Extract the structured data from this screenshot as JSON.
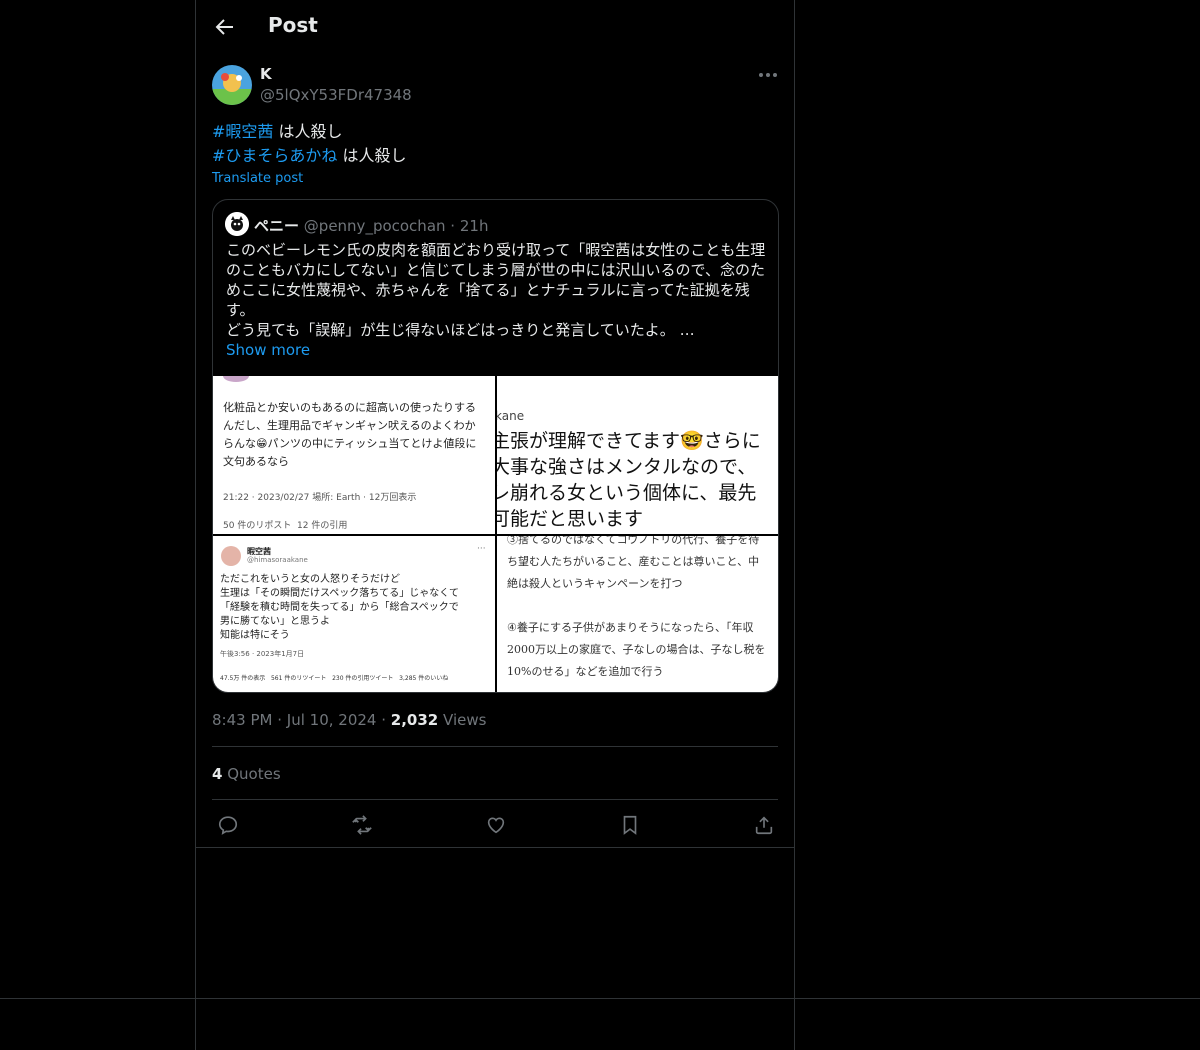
{
  "header": {
    "title": "Post"
  },
  "post": {
    "author_name": "K",
    "author_handle": "@5lQxY53FDr47348",
    "lines": [
      {
        "hashtag": "#暇空茜",
        "text": " は人殺し"
      },
      {
        "hashtag": "#ひまそらあかね",
        "text": " は人殺し"
      }
    ],
    "translate_label": "Translate post",
    "time": "8:43 PM",
    "date": "Jul 10, 2024",
    "views_count": "2,032",
    "views_label": "Views",
    "quotes_count": "4",
    "quotes_label": "Quotes"
  },
  "quote": {
    "name": "ペニー",
    "handle": "@penny_pocochan",
    "separator": "·",
    "time": "21h",
    "text": "このベビーレモン氏の皮肉を額面どおり受け取って「暇空茜は女性のことも生理のこともバカにしてない」と信じてしまう層が世の中には沢山いるので、念のためここに女性蔑視や、赤ちゃんを「捨てる」とナチュラルに言ってた証拠を残す。\nどう見ても「誤解」が生じ得ないほどはっきりと発言していたよ。 …",
    "show_more": "Show more",
    "images": {
      "img1": {
        "line1": "化粧品とか安いのもあるのに超高いの使ったりするんだし、生理用品でギャンギャン吠えるのよくわからんな😁パンツの中にティッシュ当てとけよ値段に文句あるなら",
        "meta": "21:22 · 2023/02/27 場所: Earth · 12万回表示",
        "stats": "50 件のリポスト  12 件の引用"
      },
      "img2": {
        "top": "kane",
        "line1": "主張が理解できてます🤓さらに",
        "line2": "大事な強さはメンタルなので、",
        "line3": "レ崩れる女という個体に、最先",
        "line4": "可能だと思います"
      },
      "img3": {
        "name": "暇空茜",
        "handle": "@himasoraakane",
        "text": "ただこれをいうと女の人怒りそうだけど\n生理は「その瞬間だけスペック落ちてる」じゃなくて\n「経験を積む時間を失ってる」から「総合スペックで\n男に勝てない」と思うよ\n知能は特にそう",
        "meta": "午後3:56 · 2023年1月7日",
        "stats": "47.5万 件の表示   561 件のリツイート   230 件の引用ツイート   3,285 件のいいね"
      },
      "img4": {
        "text": "③捨てるのではなくてコウノトリの代行、養子を待ち望む人たちがいること、産むことは尊いこと、中絶は殺人というキャンペーンを打つ\n\n④養子にする子供があまりそうになったら、「年収2000万以上の家庭で、子なしの場合は、子なし税を10%のせる」などを追加で行う"
      }
    }
  },
  "icons": {
    "back": "arrow-left-icon",
    "more": "more-horizontal-icon",
    "reply": "reply-icon",
    "repost": "repost-icon",
    "like": "heart-icon",
    "bookmark": "bookmark-icon",
    "share": "share-icon"
  },
  "colors": {
    "background": "#000000",
    "text": "#e7e9ea",
    "muted": "#71767b",
    "accent": "#1d9bf0",
    "border": "#2f3336"
  }
}
